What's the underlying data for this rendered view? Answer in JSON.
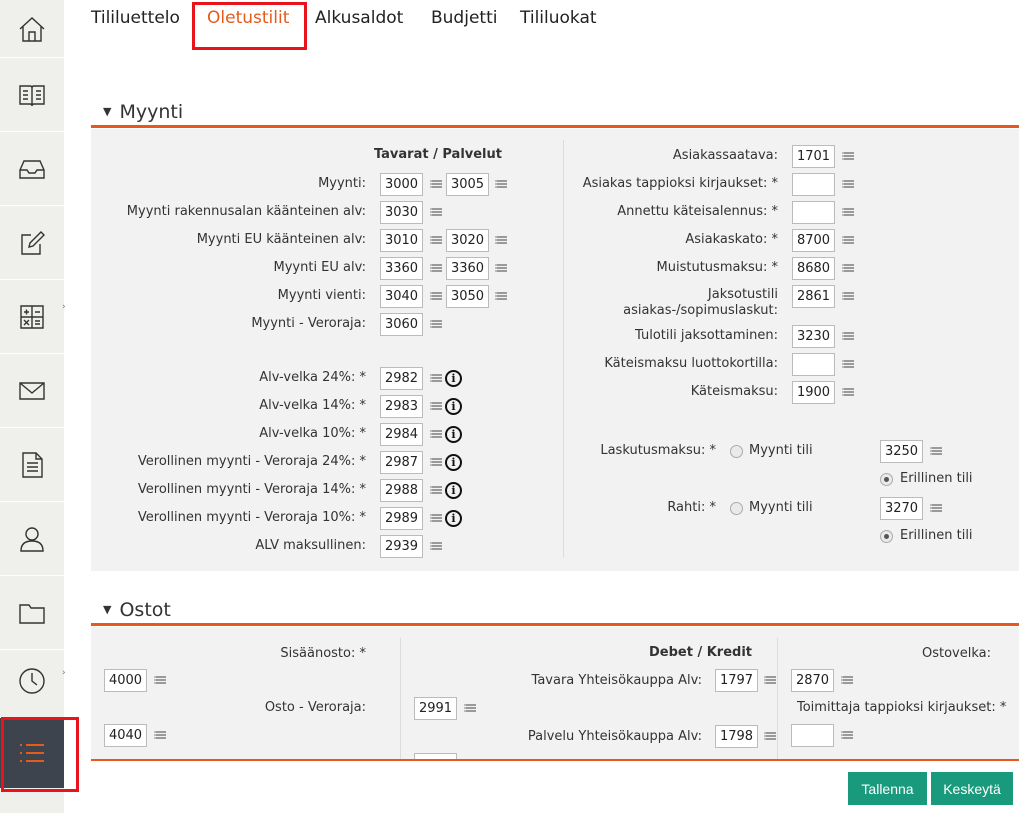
{
  "tabs": [
    {
      "label": "Tililuettelo"
    },
    {
      "label": "Oletustilit"
    },
    {
      "label": "Alkusaldot"
    },
    {
      "label": "Budjetti"
    },
    {
      "label": "Tililuokat"
    }
  ],
  "sidebar": {
    "icons": [
      "home-icon",
      "book-icon",
      "inbox-icon",
      "edit-icon",
      "calculator-icon",
      "mail-icon",
      "document-icon",
      "user-icon",
      "folder-icon",
      "clock-icon",
      "list-icon"
    ]
  },
  "myynti": {
    "title": "Myynti",
    "col_header": "Tavarat / Palvelut",
    "rows": [
      {
        "label": "Myynti:",
        "v1": "3000",
        "v2": "3005"
      },
      {
        "label": "Myynti rakennusalan käänteinen alv:",
        "v1": "3030",
        "v2": ""
      },
      {
        "label": "Myynti EU käänteinen alv:",
        "v1": "3010",
        "v2": "3020"
      },
      {
        "label": "Myynti EU alv:",
        "v1": "3360",
        "v2": "3360"
      },
      {
        "label": "Myynti vienti:",
        "v1": "3040",
        "v2": "3050"
      },
      {
        "label": "Myynti - Veroraja:",
        "v1": "3060",
        "v2": ""
      }
    ],
    "vat_rows": [
      {
        "label": "Alv-velka 24%: *",
        "value": "2982"
      },
      {
        "label": "Alv-velka 14%: *",
        "value": "2983"
      },
      {
        "label": "Alv-velka 10%: *",
        "value": "2984"
      },
      {
        "label": "Verollinen myynti - Veroraja 24%: *",
        "value": "2987"
      },
      {
        "label": "Verollinen myynti - Veroraja 14%: *",
        "value": "2988"
      },
      {
        "label": "Verollinen myynti - Veroraja 10%: *",
        "value": "2989"
      },
      {
        "label": "ALV maksullinen:",
        "value": "2939"
      }
    ],
    "right_rows": [
      {
        "label": "Asiakassaatava:",
        "value": "1701"
      },
      {
        "label": "Asiakas tappioksi kirjaukset: *",
        "value": ""
      },
      {
        "label": "Annettu käteisalennus: *",
        "value": ""
      },
      {
        "label": "Asiakaskato: *",
        "value": "8700"
      },
      {
        "label": "Muistutusmaksu: *",
        "value": "8680"
      },
      {
        "label": "Jaksotustili",
        "label2": "asiakas-/sopimuslaskut:",
        "value": "2861"
      },
      {
        "label": "Tulotili jaksottaminen:",
        "value": "3230"
      },
      {
        "label": "Käteismaksu luottokortilla:",
        "value": ""
      },
      {
        "label": "Käteismaksu:",
        "value": "1900"
      }
    ],
    "laskutus": {
      "label": "Laskutusmaksu: *",
      "opt1": "Myynti tili",
      "opt2": "Erillinen tili",
      "value": "3250"
    },
    "rahti": {
      "label": "Rahti: *",
      "opt1": "Myynti tili",
      "opt2": "Erillinen tili",
      "value": "3270"
    }
  },
  "ostot": {
    "title": "Ostot",
    "sisaanosto": {
      "label": "Sisäänosto: *",
      "value": "4000"
    },
    "osto_veroraja": {
      "label": "Osto - Veroraja:",
      "value": "4040"
    },
    "col_header": "Debet / Kredit",
    "mid_first": "2991",
    "mid_rows": [
      {
        "label": "Tavara Yhteisökauppa Alv:",
        "value": "1797"
      },
      {
        "label": "Palvelu Yhteisökauppa Alv:",
        "value": "1798"
      }
    ],
    "ostovelka": {
      "label": "Ostovelka:",
      "value": "2870"
    },
    "toimittaja": {
      "label": "Toimittaja tappioksi kirjaukset: *",
      "value": ""
    }
  },
  "buttons": {
    "save": "Tallenna",
    "cancel": "Keskeytä"
  },
  "colors": {
    "accent": "#e55b1b",
    "button": "#1a9a7c",
    "highlight": "#e8131b"
  }
}
